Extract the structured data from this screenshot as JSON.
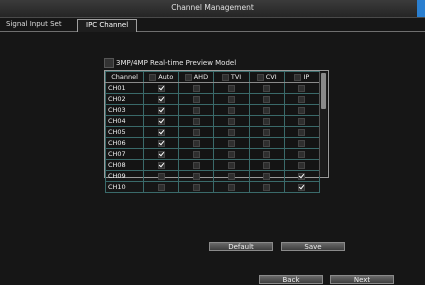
{
  "window": {
    "title": "Channel Management"
  },
  "tabs": [
    {
      "label": "Signal Input Set"
    },
    {
      "label": "IPC Channel"
    }
  ],
  "preview": {
    "label": "3MP/4MP Real-time Preview Model",
    "checked": false
  },
  "grid": {
    "columns": [
      "Channel",
      "Auto",
      "AHD",
      "TVI",
      "CVI",
      "IP"
    ],
    "rows": [
      {
        "channel": "CH01",
        "mode": "Auto"
      },
      {
        "channel": "CH02",
        "mode": "Auto"
      },
      {
        "channel": "CH03",
        "mode": "Auto"
      },
      {
        "channel": "CH04",
        "mode": "Auto"
      },
      {
        "channel": "CH05",
        "mode": "Auto"
      },
      {
        "channel": "CH06",
        "mode": "Auto"
      },
      {
        "channel": "CH07",
        "mode": "Auto"
      },
      {
        "channel": "CH08",
        "mode": "Auto"
      },
      {
        "channel": "CH09",
        "mode": "IP"
      },
      {
        "channel": "CH10",
        "mode": "IP"
      }
    ]
  },
  "buttons": {
    "default": "Default",
    "save": "Save",
    "back": "Back",
    "next": "Next"
  },
  "colors": {
    "check": "#ffffff",
    "accent": "#2a7fd0",
    "grid_line": "#3a6a6a"
  }
}
